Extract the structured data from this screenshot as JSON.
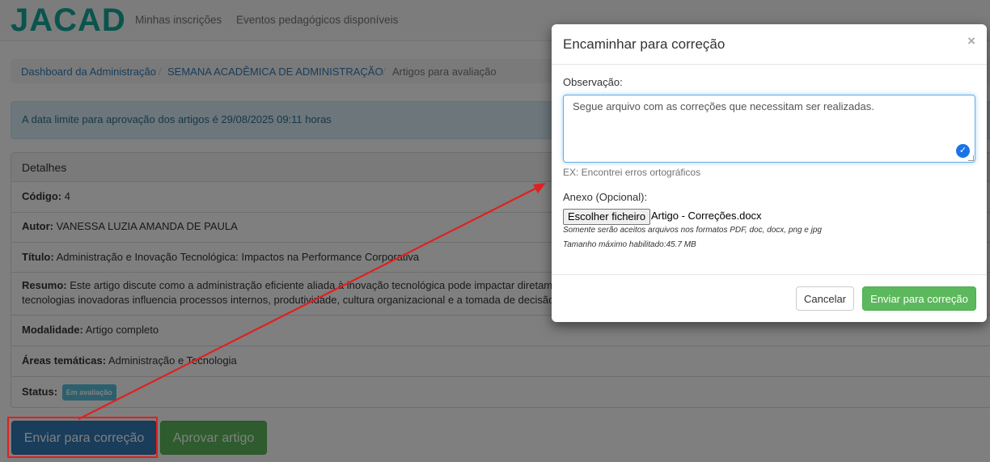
{
  "navbar": {
    "logo": "JACAD",
    "links": [
      "Minhas inscrições",
      "Eventos pedagógicos disponíveis"
    ]
  },
  "breadcrumb": {
    "items": [
      "Dashboard da Administração",
      "SEMANA ACADÊMICA DE ADMINISTRAÇÃO",
      "Artigos para avaliação"
    ],
    "separator": "/"
  },
  "alert": {
    "text": "A data limite para aprovação dos artigos é 29/08/2025 09:11 horas"
  },
  "details": {
    "heading": "Detalhes",
    "codigo_label": "Código:",
    "codigo_value": "4",
    "autor_label": "Autor:",
    "autor_value": "VANESSA LUZIA AMANDA DE PAULA",
    "titulo_label": "Título:",
    "titulo_value": "Administração e Inovação Tecnológica: Impactos na Performance Corporativa",
    "resumo_label": "Resumo:",
    "resumo_line1": "Este artigo discute como a administração eficiente aliada à inovação tecnológica pode impactar diretamente",
    "resumo_line2": "tecnologias inovadoras influencia processos internos, produtividade, cultura organizacional e a tomada de decisão. P",
    "modalidade_label": "Modalidade:",
    "modalidade_value": "Artigo completo",
    "areas_label": "Áreas temáticas:",
    "areas_value": "Administração e Tecnologia",
    "status_label": "Status:",
    "status_badge": "Em avaliação"
  },
  "actions": {
    "send_label": "Enviar para correção",
    "approve_label": "Aprovar artigo"
  },
  "modal": {
    "title": "Encaminhar para correção",
    "close_symbol": "×",
    "obs_label": "Observação:",
    "obs_value": "Segue arquivo com as correções que necessitam ser realizadas.",
    "obs_help": "EX: Encontrei erros ortográficos",
    "anexo_label": "Anexo (Opcional):",
    "file_button": "Escolher ficheiro",
    "file_name": "Artigo - Correções.docx",
    "formats_note": "Somente serão aceitos arquivos nos formatos PDF, doc, docx, png e jpg",
    "max_size_note": "Tamanho máximo habilitado:45.7 MB",
    "cancel_label": "Cancelar",
    "submit_label": "Enviar para correção"
  },
  "colors": {
    "brand": "#15a89a",
    "primary": "#337ab7",
    "success": "#5cb85c",
    "info": "#5bc0de",
    "annotation": "#e02020"
  }
}
